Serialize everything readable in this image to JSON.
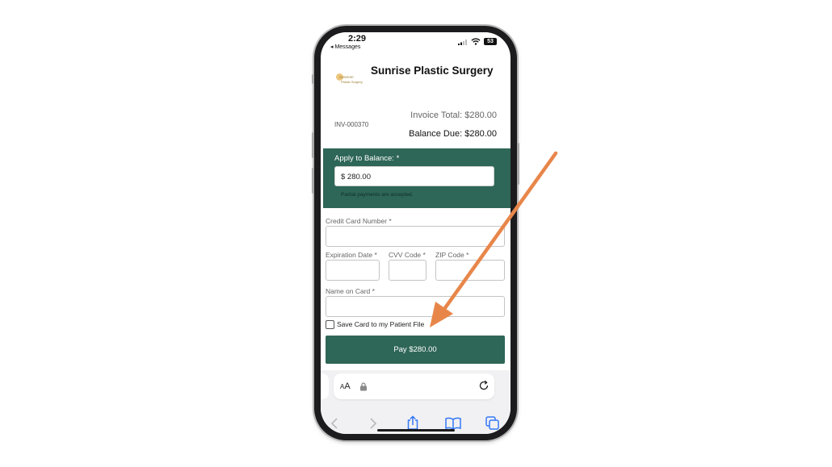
{
  "status_bar": {
    "time": "2:29",
    "back_app": "◂ Messages",
    "battery": "53"
  },
  "header": {
    "logo_line1": "SUNRISE",
    "logo_line2": "Plastic Surgery",
    "title": "Sunrise Plastic Surgery"
  },
  "invoice": {
    "number": "INV-000370",
    "total_label": "Invoice Total: $280.00",
    "balance_label": "Balance Due: $280.00"
  },
  "apply": {
    "label": "Apply to Balance: *",
    "value": "$ 280.00",
    "note": "Partial payments are accepted."
  },
  "form": {
    "card_number_label": "Credit Card Number *",
    "expiration_label": "Expiration Date *",
    "cvv_label": "CVV Code *",
    "zip_label": "ZIP Code *",
    "name_label": "Name on Card *",
    "save_card_label": "Save Card to my Patient File",
    "pay_button": "Pay $280.00"
  },
  "browser": {
    "aa_big": "A",
    "aa_small": "A",
    "icons": [
      "back-icon",
      "forward-icon",
      "share-icon",
      "bookmarks-icon",
      "tabs-icon",
      "lock-icon",
      "reload-icon"
    ]
  },
  "colors": {
    "brand_green": "#2e6657",
    "annotation_arrow": "#e8864a",
    "ios_blue": "#3478f6"
  }
}
